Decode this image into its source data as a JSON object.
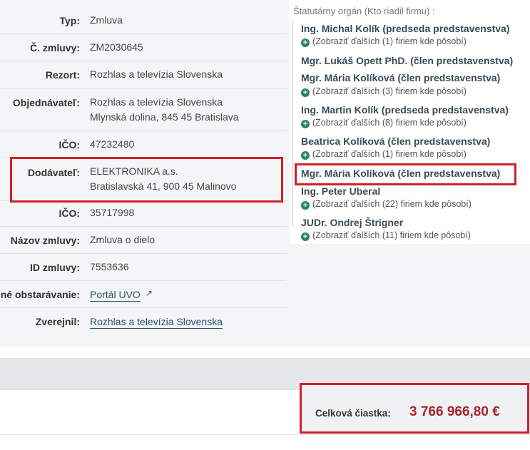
{
  "details": [
    {
      "label": "Typ:",
      "lines": [
        "Zmluva"
      ]
    },
    {
      "label": "Č. zmluvy:",
      "lines": [
        "ZM2030645"
      ]
    },
    {
      "label": "Rezort:",
      "lines": [
        "Rozhlas a televízia Slovenska"
      ]
    },
    {
      "label": "Objednávateľ:",
      "lines": [
        "Rozhlas a televízia Slovenska",
        "Mlynská dolina, 845 45 Bratislava"
      ]
    },
    {
      "label": "IČO:",
      "lines": [
        "47232480"
      ]
    },
    {
      "label": "Dodávateľ:",
      "lines": [
        "ELEKTRONIKA a.s.",
        "Bratislavská 41, 900 45 Malinovo"
      ]
    },
    {
      "label": "IČO:",
      "lines": [
        "35717998"
      ]
    },
    {
      "label": "Názov zmluvy:",
      "lines": [
        "Zmluva o dielo"
      ]
    },
    {
      "label": "ID zmluvy:",
      "lines": [
        "7553636"
      ]
    },
    {
      "label": "né obstarávanie:",
      "lines": [
        "Portál UVO"
      ],
      "external_icon": "↗"
    },
    {
      "label": "Zverejnil:",
      "lines": [
        "Rozhlas a televízia Slovenska"
      ]
    }
  ],
  "statutory": {
    "title": "Štatutárny orgán (Kto riadil firmu) :",
    "members": [
      {
        "name": "Ing. Michal Kolík (predseda predstavenstva)",
        "more": "(Zobraziť ďalších (1) firiem kde pôsobí)"
      },
      {
        "name": "Mgr. Lukáš Opett PhD. (člen predstavenstva)",
        "more": ""
      },
      {
        "name": "Mgr. Mária Kolíková (člen predstavenstva)",
        "more": "(Zobraziť ďalších (3) firiem kde pôsobí)"
      },
      {
        "name": "Ing. Martin Kolík (predseda predstavenstva)",
        "more": "(Zobraziť ďalších (8) firiem kde pôsobí)"
      },
      {
        "name": "Beatrica Kolíková (člen predstavenstva)",
        "more": "(Zobraziť ďalších (1) firiem kde pôsobí)"
      },
      {
        "name": "Mgr. Mária Kolíková (člen predstavenstva)",
        "more": ""
      },
      {
        "name": "Ing. Peter Uberal",
        "more": "(Zobraziť ďalších (22) firiem kde pôsobí)"
      },
      {
        "name": "JUDr. Ondrej Štrigner",
        "more": "(Zobraziť ďalších (11) firiem kde pôsobí)"
      }
    ]
  },
  "total": {
    "label": "Celková čiastka:",
    "value": "3 766 966,80 €"
  },
  "colors": {
    "highlight": "#d0202a",
    "amount": "#a8232d",
    "plus_icon": "#27875a"
  }
}
